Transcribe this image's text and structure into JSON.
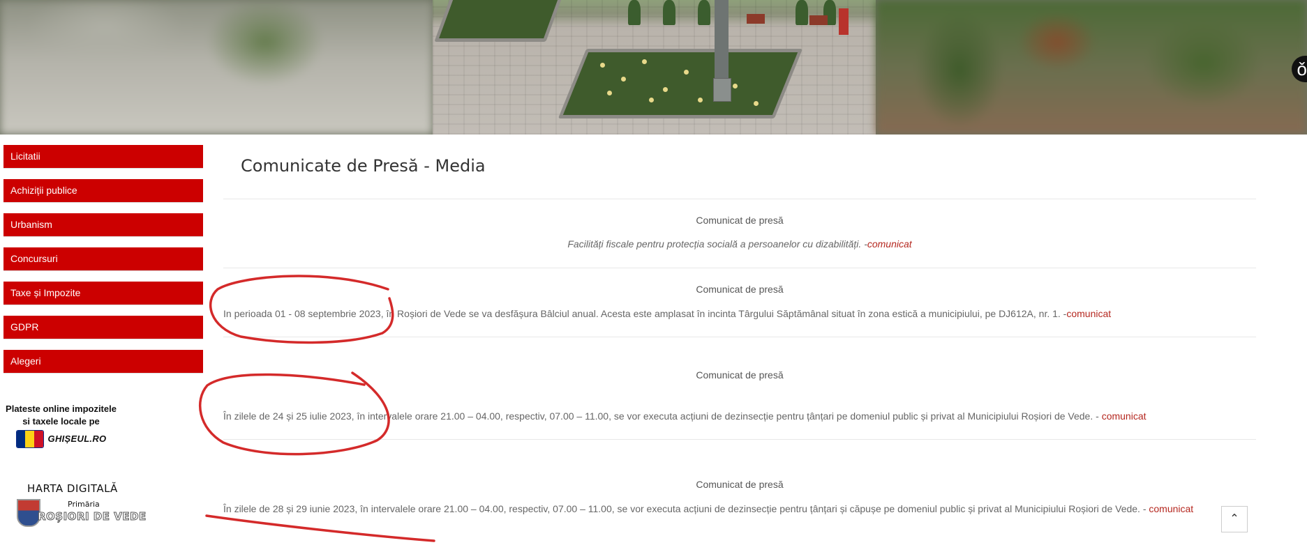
{
  "banner": {
    "accessibility_glyph": "ǒ"
  },
  "sidebar": {
    "items": [
      {
        "label": "Licitatii"
      },
      {
        "label": "Achiziții publice"
      },
      {
        "label": "Urbanism"
      },
      {
        "label": "Concursuri"
      },
      {
        "label": "Taxe și Impozite"
      },
      {
        "label": "GDPR"
      },
      {
        "label": "Alegeri"
      }
    ],
    "ghiseul": {
      "line1": "Plateste online impozitele",
      "line2": "si taxele locale pe",
      "logo_text": "GHIȘEUL.RO"
    },
    "harta": {
      "title": "HARTA DIGITALĂ",
      "primaria": "Primăria",
      "city": "ROȘIORI DE VEDE"
    }
  },
  "main": {
    "title": "Comunicate de Presă - Media",
    "releases": [
      {
        "heading": "Comunicat de presă",
        "text": "Facilități fiscale pentru protecția socială a persoanelor cu dizabilități. -",
        "link": "comunicat"
      },
      {
        "heading": "Comunicat de presă",
        "text": "In perioada 01 - 08 septembrie 2023, în Roșiori de Vede se va desfășura Bâlciul anual. Acesta este amplasat în incinta Târgului Săptămânal situat în zona estică a municipiului, pe DJ612A, nr. 1. -",
        "link": "comunicat"
      },
      {
        "heading": "Comunicat de presă",
        "text": "În zilele de 24 și 25 iulie 2023, în intervalele orare 21.00 – 04.00, respectiv, 07.00 – 11.00, se vor executa acțiuni de dezinsecție pentru țânțari pe domeniul public și privat al Municipiului Roșiori de Vede. - ",
        "link": "comunicat"
      },
      {
        "heading": "Comunicat de presă",
        "text": "În zilele de 28 și 29 iunie 2023, în intervalele orare 21.00 – 04.00, respectiv, 07.00 – 11.00,  se vor executa acțiuni de dezinsecție pentru țânțari și căpușe pe domeniul public și privat al Municipiului Roșiori de Vede. - ",
        "link": "comunicat"
      }
    ]
  },
  "scroll_top": {
    "icon": "chevron-up-icon",
    "glyph": "⌃"
  },
  "colors": {
    "menu_red": "#cc0000",
    "link_red": "#b5271f",
    "annotation_red": "#d42a2a"
  }
}
